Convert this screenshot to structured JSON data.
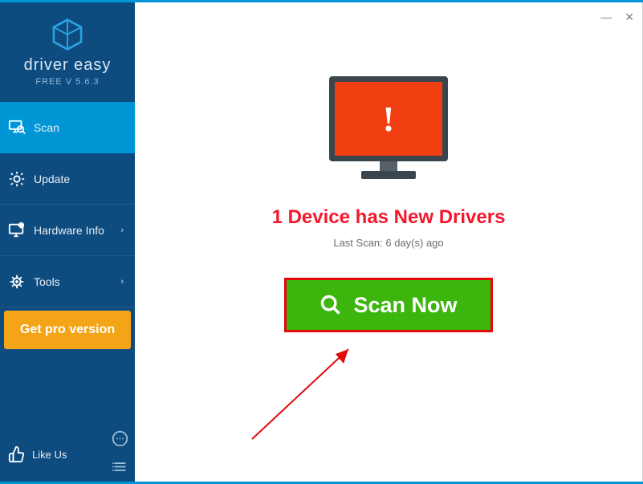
{
  "app": {
    "brand": "driver easy",
    "version": "FREE V 5.6.3"
  },
  "sidebar": {
    "items": [
      {
        "label": "Scan"
      },
      {
        "label": "Update"
      },
      {
        "label": "Hardware Info"
      },
      {
        "label": "Tools"
      }
    ],
    "pro_button": "Get pro version",
    "like_label": "Like Us"
  },
  "main": {
    "headline": "1 Device has New Drivers",
    "last_scan": "Last Scan: 6 day(s) ago",
    "scan_button": "Scan Now"
  },
  "window": {
    "minimize": "—",
    "close": "✕"
  }
}
